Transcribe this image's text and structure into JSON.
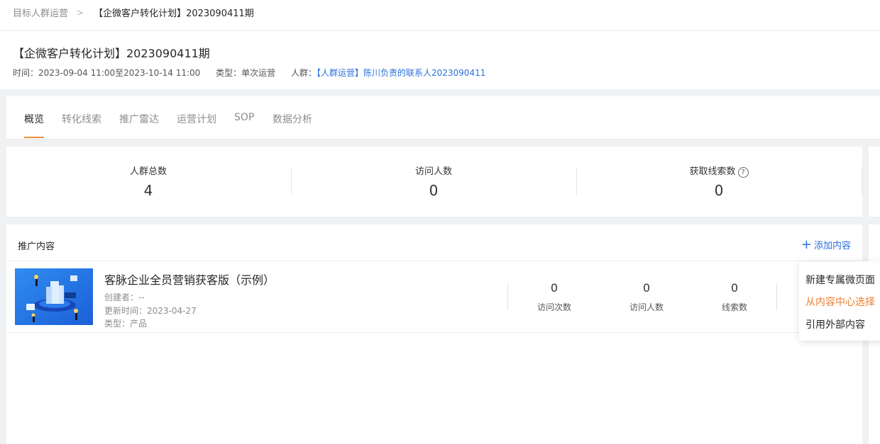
{
  "breadcrumb": {
    "parent": "目标人群运营",
    "separator": ">",
    "current": "【企微客户转化计划】2023090411期"
  },
  "header": {
    "title": "【企微客户转化计划】2023090411期",
    "time_label": "时间：",
    "time_value": "2023-09-04 11:00至2023-10-14 11:00",
    "type_label": "类型：",
    "type_value": "单次运营",
    "crowd_label": "人群：",
    "crowd_value": "【人群运营】陈川负责的联系人2023090411"
  },
  "tabs": [
    {
      "label": "概览",
      "active": true
    },
    {
      "label": "转化线索",
      "active": false
    },
    {
      "label": "推广雷达",
      "active": false
    },
    {
      "label": "运营计划",
      "active": false
    },
    {
      "label": "SOP",
      "active": false
    },
    {
      "label": "数据分析",
      "active": false
    }
  ],
  "stats": [
    {
      "label": "人群总数",
      "value": "4"
    },
    {
      "label": "访问人数",
      "value": "0"
    },
    {
      "label": "获取线索数",
      "value": "0",
      "help_icon": "question-circle-icon"
    }
  ],
  "promo": {
    "title": "推广内容",
    "add_label": "添加内容",
    "items": [
      {
        "title": "客脉企业全员营销获客版（示例）",
        "creator": "创建者：--",
        "updated": "更新时间：2023-04-27",
        "type": "类型：产品",
        "metrics": [
          {
            "value": "0",
            "label": "访问次数"
          },
          {
            "value": "0",
            "label": "访问人数"
          },
          {
            "value": "0",
            "label": "线索数"
          }
        ]
      }
    ]
  },
  "dropdown": {
    "items": [
      {
        "label": "新建专属微页面",
        "highlight": false
      },
      {
        "label": "从内容中心选择",
        "highlight": true
      },
      {
        "label": "引用外部内容",
        "highlight": false
      }
    ]
  },
  "colors": {
    "accent_blue": "#2b6fe0",
    "accent_orange": "#ef7d2d",
    "background": "#f0f1f3"
  }
}
